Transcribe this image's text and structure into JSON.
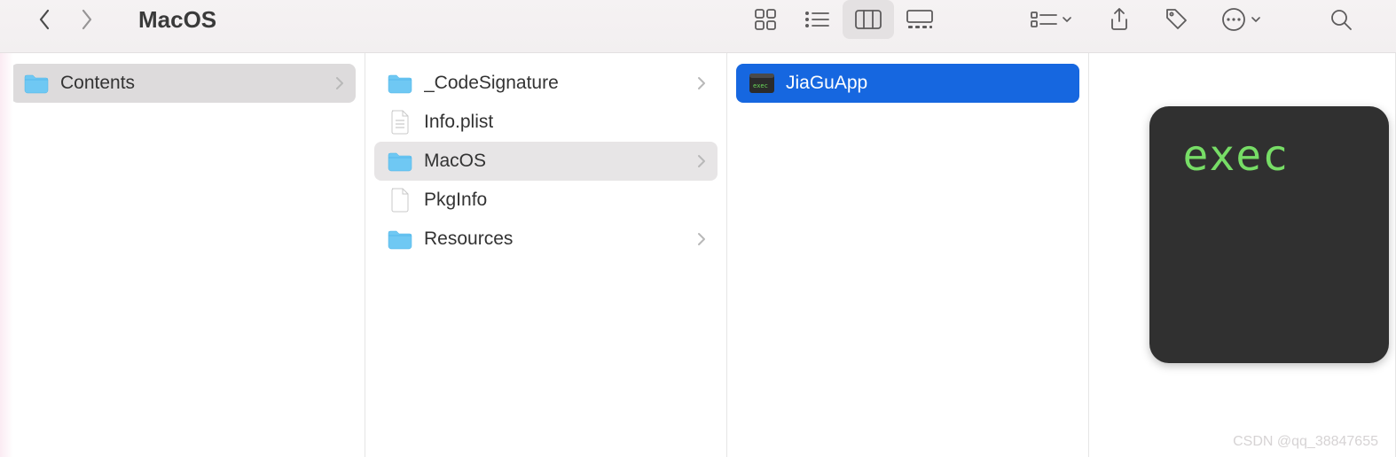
{
  "toolbar": {
    "title": "MacOS"
  },
  "columns": [
    {
      "items": [
        {
          "icon": "folder",
          "label": "Contents",
          "disclosure": true,
          "sel": "gray"
        }
      ]
    },
    {
      "items": [
        {
          "icon": "folder",
          "label": "_CodeSignature",
          "disclosure": true,
          "sel": ""
        },
        {
          "icon": "plist",
          "label": "Info.plist",
          "disclosure": false,
          "sel": ""
        },
        {
          "icon": "folder",
          "label": "MacOS",
          "disclosure": true,
          "sel": "gray2"
        },
        {
          "icon": "doc",
          "label": "PkgInfo",
          "disclosure": false,
          "sel": ""
        },
        {
          "icon": "folder",
          "label": "Resources",
          "disclosure": true,
          "sel": ""
        }
      ]
    },
    {
      "items": [
        {
          "icon": "term",
          "label": "JiaGuApp",
          "disclosure": false,
          "sel": "blue"
        }
      ]
    }
  ],
  "preview": {
    "label": "exec"
  },
  "watermark": "CSDN @qq_38847655"
}
